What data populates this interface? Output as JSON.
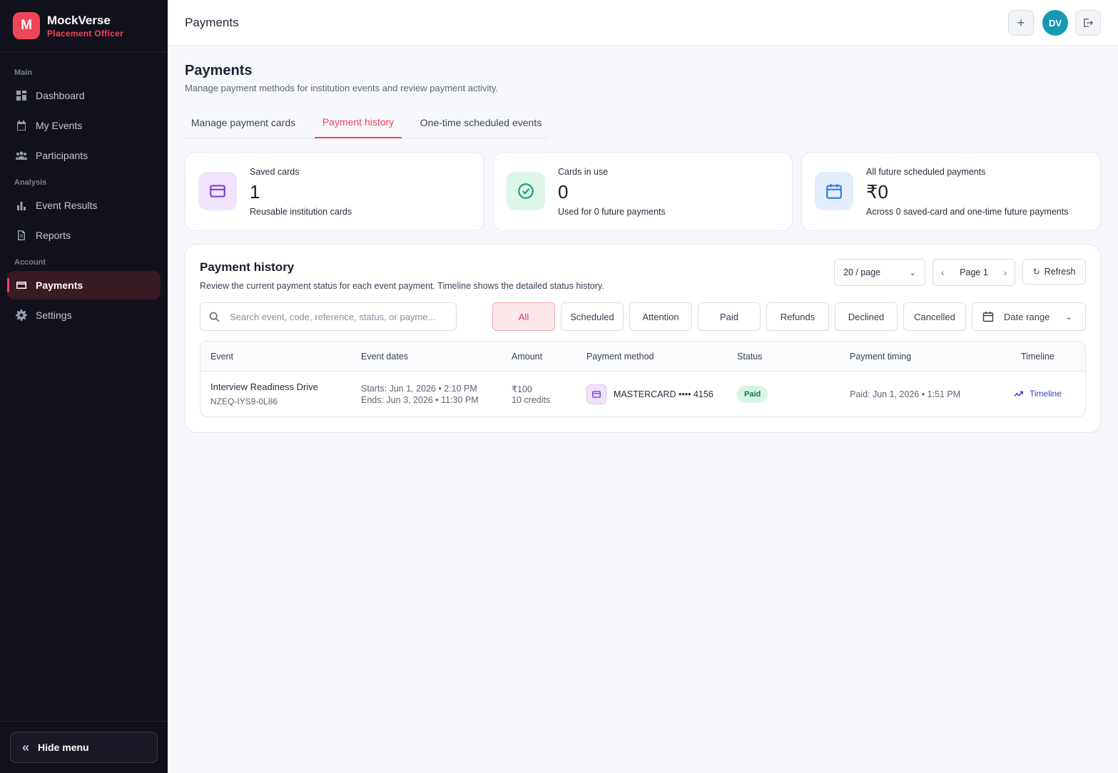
{
  "brand": {
    "logo_letter": "M",
    "name": "MockVerse",
    "role": "Placement Officer"
  },
  "sidebar": {
    "sections": {
      "main": "Main",
      "analysis": "Analysis",
      "account": "Account"
    },
    "items": [
      {
        "label": "Dashboard"
      },
      {
        "label": "My Events"
      },
      {
        "label": "Participants"
      },
      {
        "label": "Event Results"
      },
      {
        "label": "Reports"
      },
      {
        "label": "Payments"
      },
      {
        "label": "Settings"
      }
    ],
    "hide_menu": "Hide menu"
  },
  "topbar": {
    "title": "Payments",
    "avatar_initials": "DV"
  },
  "page": {
    "title": "Payments",
    "subtitle": "Manage payment methods for institution events and review payment activity."
  },
  "tabs": [
    {
      "label": "Manage payment cards"
    },
    {
      "label": "Payment history"
    },
    {
      "label": "One-time scheduled events"
    }
  ],
  "stats": [
    {
      "label": "Saved cards",
      "value": "1",
      "desc": "Reusable institution cards"
    },
    {
      "label": "Cards in use",
      "value": "0",
      "desc": "Used for 0 future payments"
    },
    {
      "label": "All future scheduled payments",
      "value": "₹0",
      "desc": "Across 0 saved-card and one-time future payments"
    }
  ],
  "history": {
    "title": "Payment history",
    "subtitle": "Review the current payment status for each event payment. Timeline shows the detailed status history.",
    "per_page": "20 / page",
    "page": "Page 1",
    "refresh": "Refresh",
    "search_placeholder": "Search event, code, reference, status, or payme...",
    "filters": [
      "All",
      "Scheduled",
      "Attention",
      "Paid",
      "Refunds",
      "Declined",
      "Cancelled"
    ],
    "date_range": "Date range",
    "columns": [
      "Event",
      "Event dates",
      "Amount",
      "Payment method",
      "Status",
      "Payment timing",
      "Timeline"
    ],
    "rows": [
      {
        "event": "Interview Readiness Drive",
        "code": "NZEQ-IYS9-0L86",
        "starts": "Starts: Jun 1, 2026 • 2:10 PM",
        "ends": "Ends: Jun 3, 2026 • 11:30 PM",
        "amount": "₹100",
        "credits": "10 credits",
        "method": "MASTERCARD •••• 4156",
        "status": "Paid",
        "timing": "Paid: Jun 1, 2026 • 1:51 PM",
        "timeline": "Timeline"
      }
    ]
  },
  "colors": {
    "accent": "#f0445b",
    "sidebar_bg": "#12121c",
    "paid_bg": "#d7f5e6",
    "avatar": "#1699b2"
  }
}
